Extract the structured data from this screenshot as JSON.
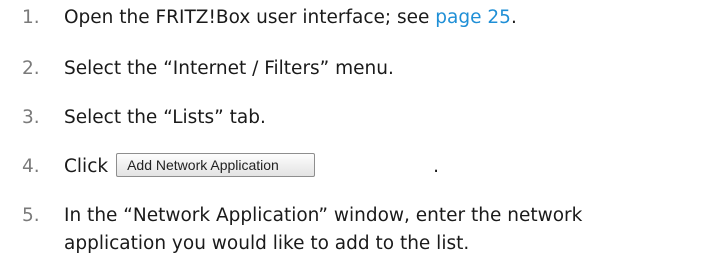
{
  "steps": [
    {
      "number": "1.",
      "text_before": "Open the FRITZ!Box user interface; see ",
      "link": "page 25",
      "text_after": "."
    },
    {
      "number": "2.",
      "text": "Select the “Internet / Filters” menu."
    },
    {
      "number": "3.",
      "text": "Select the “Lists” tab."
    },
    {
      "number": "4.",
      "text_before": "Click",
      "button_label": "Add Network Application",
      "text_after": "."
    },
    {
      "number": "5.",
      "line1": "In the “Network Application” window, enter the network",
      "line2": "application you would like to add to the list."
    }
  ],
  "colors": {
    "text": "#1a1a1a",
    "number": "#7a7a7a",
    "link": "#1f8fd6"
  }
}
